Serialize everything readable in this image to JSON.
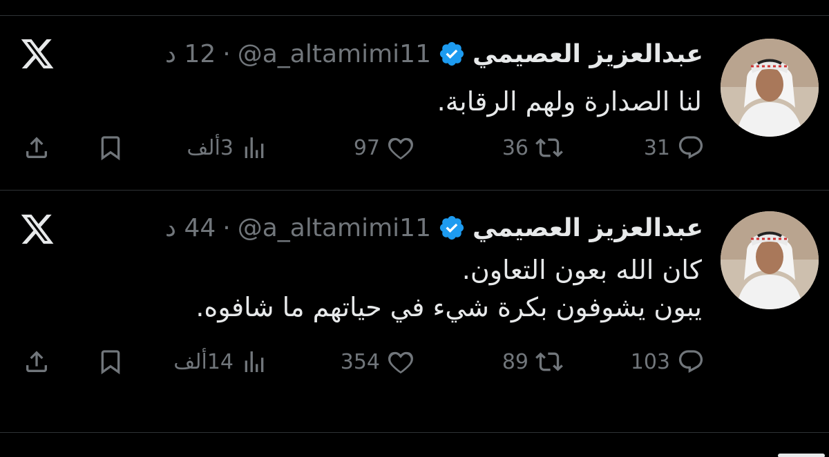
{
  "tweets": [
    {
      "author_name": "عبدالعزيز العصيمي",
      "handle": "@a_altamimi11",
      "separator": "·",
      "time": "12 د",
      "text_lines": [
        "لنا الصدارة ولهم الرقابة."
      ],
      "replies": "31",
      "retweets": "36",
      "likes": "97",
      "views": "3ألف"
    },
    {
      "author_name": "عبدالعزيز العصيمي",
      "handle": "@a_altamimi11",
      "separator": "·",
      "time": "44 د",
      "text_lines": [
        "كان الله بعون التعاون.",
        "يبون يشوفون بكرة شيء في حياتهم ما شافوه."
      ],
      "replies": "103",
      "retweets": "89",
      "likes": "354",
      "views": "14ألف"
    }
  ],
  "icons": {
    "reply": "reply-icon",
    "retweet": "retweet-icon",
    "like": "heart-icon",
    "views": "views-chart-icon",
    "bookmark": "bookmark-icon",
    "share": "share-icon",
    "platform": "x-logo-icon",
    "verified": "verified-badge-icon"
  },
  "colors": {
    "background": "#000000",
    "text": "#e7e9ea",
    "muted": "#71767b",
    "verified": "#1d9bf0",
    "divider": "#2f3336"
  }
}
